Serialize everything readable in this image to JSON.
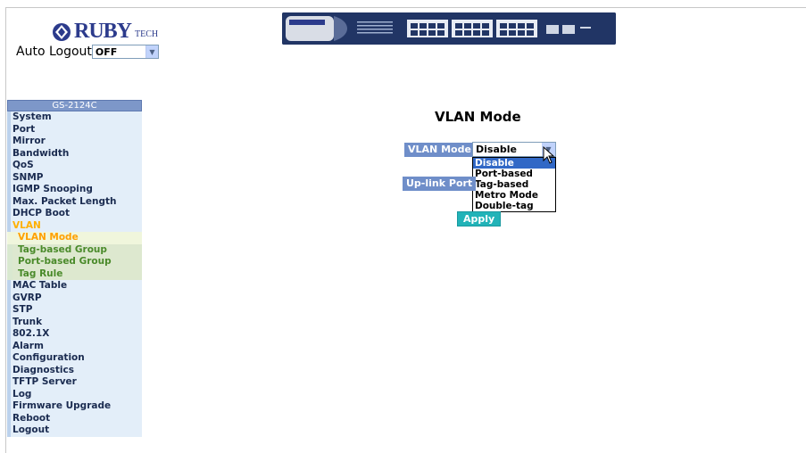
{
  "logo": {
    "brand": "RUBY",
    "suffix": "TECH"
  },
  "auto_logout": {
    "label": "Auto Logout",
    "value": "OFF"
  },
  "sidebar": {
    "title": "GS-2124C",
    "items": [
      {
        "label": "System",
        "type": "item"
      },
      {
        "label": "Port",
        "type": "item"
      },
      {
        "label": "Mirror",
        "type": "item"
      },
      {
        "label": "Bandwidth",
        "type": "item"
      },
      {
        "label": "QoS",
        "type": "item"
      },
      {
        "label": "SNMP",
        "type": "item"
      },
      {
        "label": "IGMP Snooping",
        "type": "item"
      },
      {
        "label": "Max. Packet Length",
        "type": "item"
      },
      {
        "label": "DHCP Boot",
        "type": "item"
      },
      {
        "label": "VLAN",
        "type": "group-open"
      },
      {
        "label": "VLAN Mode",
        "type": "sub-active"
      },
      {
        "label": "Tag-based Group",
        "type": "sub"
      },
      {
        "label": "Port-based Group",
        "type": "sub"
      },
      {
        "label": "Tag Rule",
        "type": "sub"
      },
      {
        "label": "MAC Table",
        "type": "item"
      },
      {
        "label": "GVRP",
        "type": "item"
      },
      {
        "label": "STP",
        "type": "item"
      },
      {
        "label": "Trunk",
        "type": "item"
      },
      {
        "label": "802.1X",
        "type": "item"
      },
      {
        "label": "Alarm",
        "type": "item"
      },
      {
        "label": "Configuration",
        "type": "item"
      },
      {
        "label": "Diagnostics",
        "type": "item"
      },
      {
        "label": "TFTP Server",
        "type": "item"
      },
      {
        "label": "Log",
        "type": "item"
      },
      {
        "label": "Firmware Upgrade",
        "type": "item"
      },
      {
        "label": "Reboot",
        "type": "item"
      },
      {
        "label": "Logout",
        "type": "item"
      }
    ]
  },
  "main": {
    "title": "VLAN Mode",
    "vlan_mode_label": "VLAN Mode",
    "vlan_mode_value": "Disable",
    "uplink_label": "Up-link Port",
    "options": [
      "Disable",
      "Port-based",
      "Tag-based",
      "Metro Mode",
      "Double-tag"
    ],
    "selected_option": "Disable",
    "apply_label": "Apply"
  },
  "colors": {
    "accent": "#6f8ec9",
    "apply": "#22b3b8",
    "highlight": "#3168c6",
    "brand": "#2c3b8c"
  }
}
